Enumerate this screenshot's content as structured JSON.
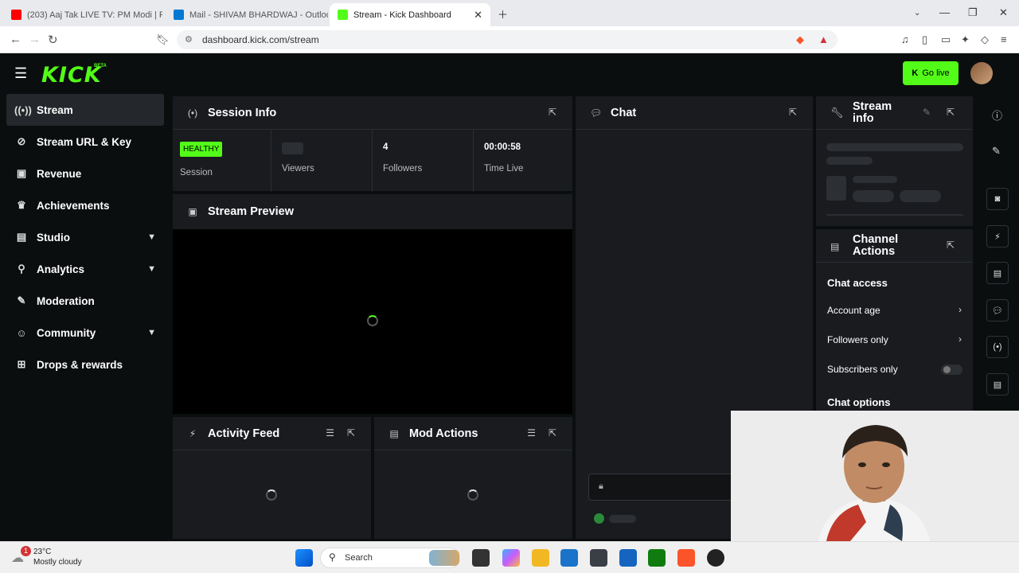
{
  "browser": {
    "tabs": [
      {
        "label": "(203) Aaj Tak LIVE TV: PM Modi | Pap",
        "fav_color": "#ff0000"
      },
      {
        "label": "Mail - SHIVAM BHARDWAJ - Outlook",
        "fav_color": "#0078d4"
      },
      {
        "label": "Stream - Kick Dashboard",
        "fav_color": "#53fc18"
      }
    ],
    "url": "dashboard.kick.com/stream"
  },
  "header": {
    "logo": "KICK",
    "beta": "BETA",
    "go_live": "Go live"
  },
  "sidebar": {
    "items": [
      {
        "label": "Stream",
        "icon": "broadcast-icon",
        "glyph": "((•))",
        "chevron": false,
        "active": true
      },
      {
        "label": "Stream URL & Key",
        "icon": "link-icon",
        "glyph": "⊘",
        "chevron": false,
        "active": false
      },
      {
        "label": "Revenue",
        "icon": "wallet-icon",
        "glyph": "▣",
        "chevron": false,
        "active": false
      },
      {
        "label": "Achievements",
        "icon": "trophy-icon",
        "glyph": "♛",
        "chevron": false,
        "active": false
      },
      {
        "label": "Studio",
        "icon": "studio-icon",
        "glyph": "▤",
        "chevron": true,
        "active": false
      },
      {
        "label": "Analytics",
        "icon": "chart-icon",
        "glyph": "⚲",
        "chevron": true,
        "active": false
      },
      {
        "label": "Moderation",
        "icon": "wrench-icon",
        "glyph": "✎",
        "chevron": false,
        "active": false
      },
      {
        "label": "Community",
        "icon": "users-icon",
        "glyph": "☺",
        "chevron": true,
        "active": false
      },
      {
        "label": "Drops & rewards",
        "icon": "gift-icon",
        "glyph": "⊞",
        "chevron": false,
        "active": false
      }
    ]
  },
  "session": {
    "title": "Session Info",
    "health_badge": "HEALTHY",
    "health_label": "Session",
    "viewers_label": "Viewers",
    "followers_value": "4",
    "followers_label": "Followers",
    "time_value": "00:00:58",
    "time_label": "Time Live"
  },
  "preview": {
    "title": "Stream Preview"
  },
  "chat": {
    "title": "Chat"
  },
  "activity": {
    "title": "Activity Feed"
  },
  "mod_actions": {
    "title": "Mod Actions"
  },
  "stream_info": {
    "title_line1": "Stream",
    "title_line2": "info"
  },
  "channel_actions": {
    "title_line1": "Channel",
    "title_line2": "Actions",
    "section1": "Chat access",
    "rows": [
      "Account age",
      "Followers only",
      "Subscribers only"
    ],
    "section2": "Chat options",
    "subscribers_only_enabled": false
  },
  "taskbar": {
    "weather_temp": "23°C",
    "weather_desc": "Mostly cloudy",
    "weather_badge": "1",
    "search": "Search"
  },
  "colors": {
    "brand": "#53fc18",
    "panel": "#191b1f",
    "page": "#0b0e0f"
  }
}
